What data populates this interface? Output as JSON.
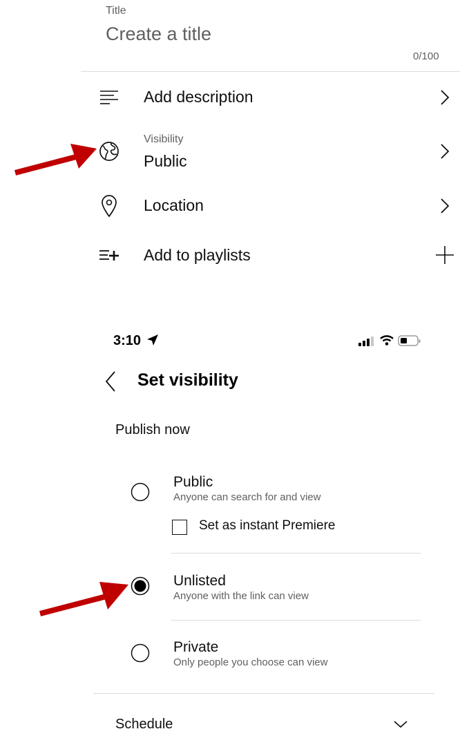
{
  "upload": {
    "title_label": "Title",
    "title_placeholder": "Create a title",
    "title_counter": "0/100",
    "rows": {
      "description": "Add description",
      "visibility_label": "Visibility",
      "visibility_value": "Public",
      "location": "Location",
      "playlists": "Add to playlists"
    }
  },
  "status_bar": {
    "time": "3:10"
  },
  "visibility_screen": {
    "title": "Set visibility",
    "section": "Publish now",
    "options": [
      {
        "title": "Public",
        "subtitle": "Anyone can search for and view",
        "selected": false
      },
      {
        "title": "Unlisted",
        "subtitle": "Anyone with the link can view",
        "selected": true
      },
      {
        "title": "Private",
        "subtitle": "Only people you choose can view",
        "selected": false
      }
    ],
    "premiere_label": "Set as instant Premiere",
    "schedule_label": "Schedule"
  },
  "colors": {
    "annotation_arrow": "#c00000",
    "text_primary": "#0f0f0f",
    "text_secondary": "#606060"
  }
}
